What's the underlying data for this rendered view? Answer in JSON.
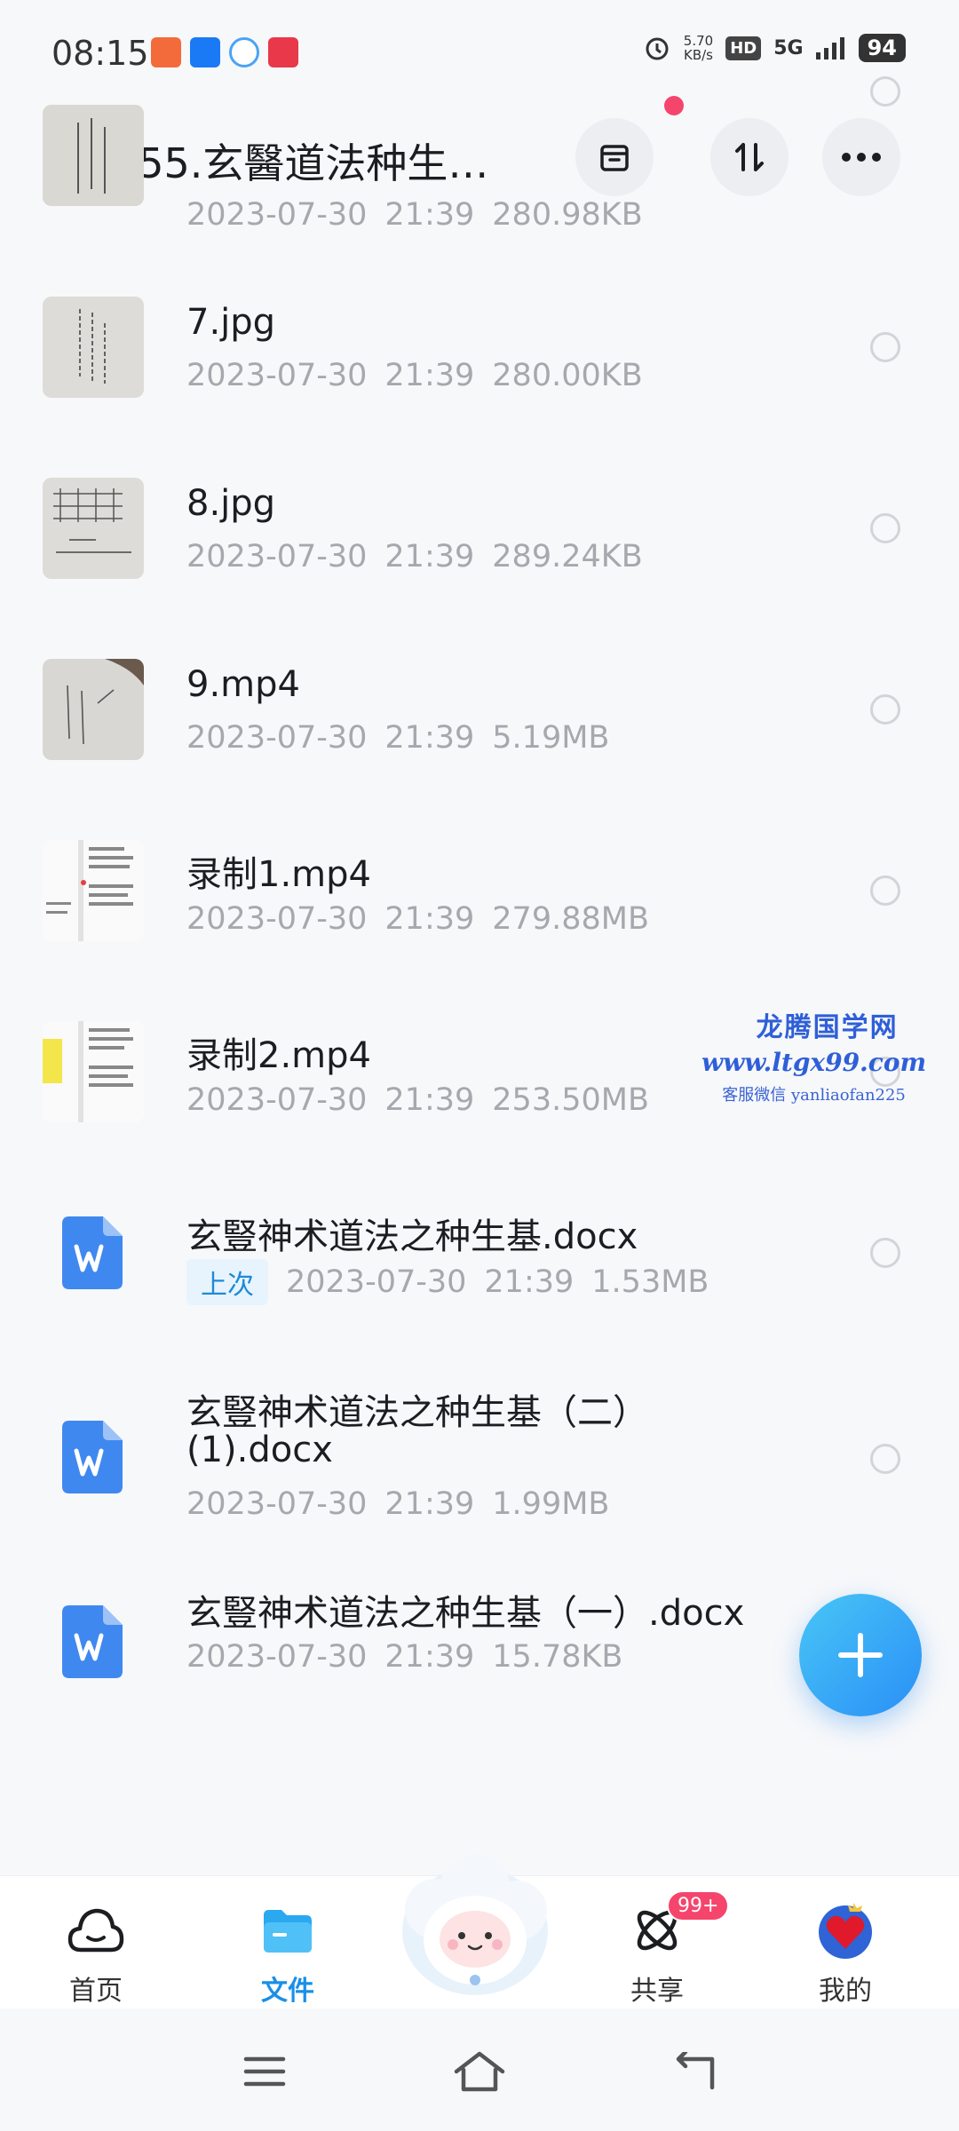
{
  "status_bar": {
    "time": "08:15",
    "net_speed_value": "5.70",
    "net_speed_unit": "KB/s",
    "hd": "HD",
    "signal": "5G",
    "battery": "94"
  },
  "header": {
    "title": "155.玄醫道法种生…"
  },
  "files": [
    {
      "name": "",
      "date": "2023-07-30",
      "time": "21:39",
      "size": "280.98KB",
      "thumb": "paper-vertical"
    },
    {
      "name": "7.jpg",
      "date": "2023-07-30",
      "time": "21:39",
      "size": "280.00KB",
      "thumb": "paper-vertical"
    },
    {
      "name": "8.jpg",
      "date": "2023-07-30",
      "time": "21:39",
      "size": "289.24KB",
      "thumb": "paper-grid"
    },
    {
      "name": "9.mp4",
      "date": "2023-07-30",
      "time": "21:39",
      "size": "5.19MB",
      "thumb": "paper-hand"
    },
    {
      "name": "录制1.mp4",
      "date": "2023-07-30",
      "time": "21:39",
      "size": "279.88MB",
      "thumb": "screen-doc"
    },
    {
      "name": "录制2.mp4",
      "date": "2023-07-30",
      "time": "21:39",
      "size": "253.50MB",
      "thumb": "screen-doc-yellow"
    },
    {
      "name": "玄豎神术道法之种生基.docx",
      "tag": "上次",
      "date": "2023-07-30",
      "time": "21:39",
      "size": "1.53MB",
      "thumb": "word-icon"
    },
    {
      "name": "玄豎神术道法之种生基（二）",
      "name2": "(1).docx",
      "date": "2023-07-30",
      "time": "21:39",
      "size": "1.99MB",
      "thumb": "word-icon"
    },
    {
      "name": "玄豎神术道法之种生基（一）.docx",
      "date": "2023-07-30",
      "time": "21:39",
      "size": "15.78KB",
      "thumb": "word-icon"
    }
  ],
  "watermark": {
    "line1": "龙腾国学网",
    "line2": "www.ltgx99.com",
    "line3": "客服微信 yanliaofan225"
  },
  "bottom_nav": {
    "items": [
      {
        "label": "首页",
        "icon": "cloud-icon"
      },
      {
        "label": "文件",
        "icon": "folder-icon",
        "active": true
      },
      {
        "label": "",
        "icon": "mascot-icon"
      },
      {
        "label": "共享",
        "icon": "atom-icon",
        "badge": "99+"
      },
      {
        "label": "我的",
        "icon": "avatar-icon"
      }
    ]
  },
  "colors": {
    "accent": "#1a8fe8",
    "badge": "#f5456c",
    "word": "#3f88f0"
  }
}
